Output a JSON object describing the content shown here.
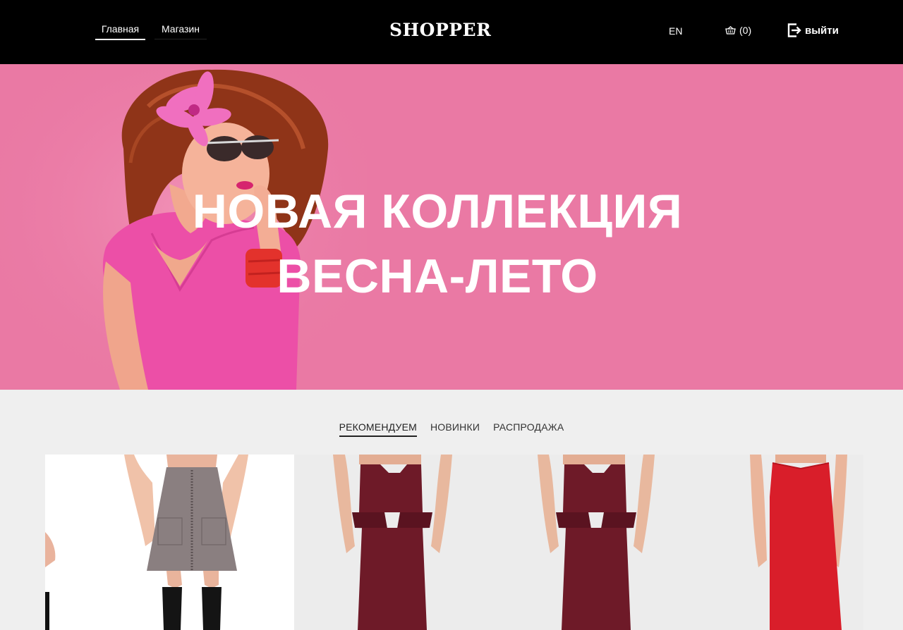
{
  "header": {
    "nav": [
      {
        "label": "Главная",
        "active": true
      },
      {
        "label": "Магазин",
        "active": false
      }
    ],
    "logo": "SHOPPER",
    "lang": "EN",
    "cart_label": "(0)",
    "logout_label": "выйти",
    "icons": {
      "cart": "basket-icon",
      "logout": "logout-icon"
    }
  },
  "hero": {
    "line1": "НОВАЯ КОЛЛЕКЦИЯ",
    "line2": "ВЕСНА-ЛЕТО",
    "background_color": "#ea79a4"
  },
  "tabs": [
    {
      "label": "РЕКОМЕНДУЕМ",
      "active": true
    },
    {
      "label": "НОВИНКИ",
      "active": false
    },
    {
      "label": "РАСПРОДАЖА",
      "active": false
    }
  ],
  "products": [
    {
      "name": "partial-product",
      "color": "#ffffff"
    },
    {
      "name": "grey-skirt",
      "color": "#8a7f80"
    },
    {
      "name": "burgundy-peplum-skirt",
      "color": "#6e1a28"
    },
    {
      "name": "burgundy-peplum-skirt",
      "color": "#6e1a28"
    },
    {
      "name": "red-pencil-skirt",
      "color": "#d91e2a"
    }
  ]
}
